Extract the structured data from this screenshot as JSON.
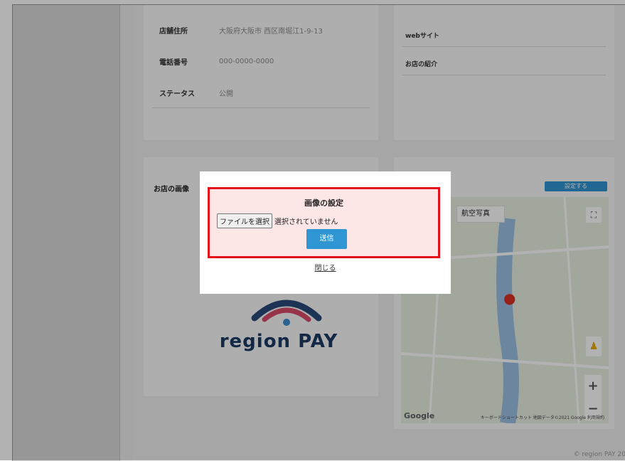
{
  "store": {
    "rows": [
      {
        "label": "店舗住所",
        "value": "大阪府大阪市 西区南堀江1-9-13"
      },
      {
        "label": "電話番号",
        "value": "000-0000-0000"
      },
      {
        "label": "ステータス",
        "value": "公開"
      }
    ]
  },
  "web": {
    "website_label": "webサイト",
    "intro_label": "お店の紹介"
  },
  "image_section": {
    "title": "お店の画像",
    "logo_text": "region PAY"
  },
  "map_section": {
    "set_button": "設定する",
    "photo_tab": "航空写真",
    "google_label": "Google",
    "attribution": "キーボードショートカット 地図データ©2021 Google 利用規約",
    "zoom_in": "+",
    "zoom_out": "−"
  },
  "footer": "© region PAY 20",
  "modal": {
    "title": "画像の設定",
    "file_button": "ファイルを選択",
    "file_status": "選択されていません",
    "submit": "送信",
    "close": "閉じる"
  },
  "colors": {
    "accent": "#2f96d3",
    "highlight_border": "#e3101b",
    "highlight_fill": "#fde6e6"
  }
}
